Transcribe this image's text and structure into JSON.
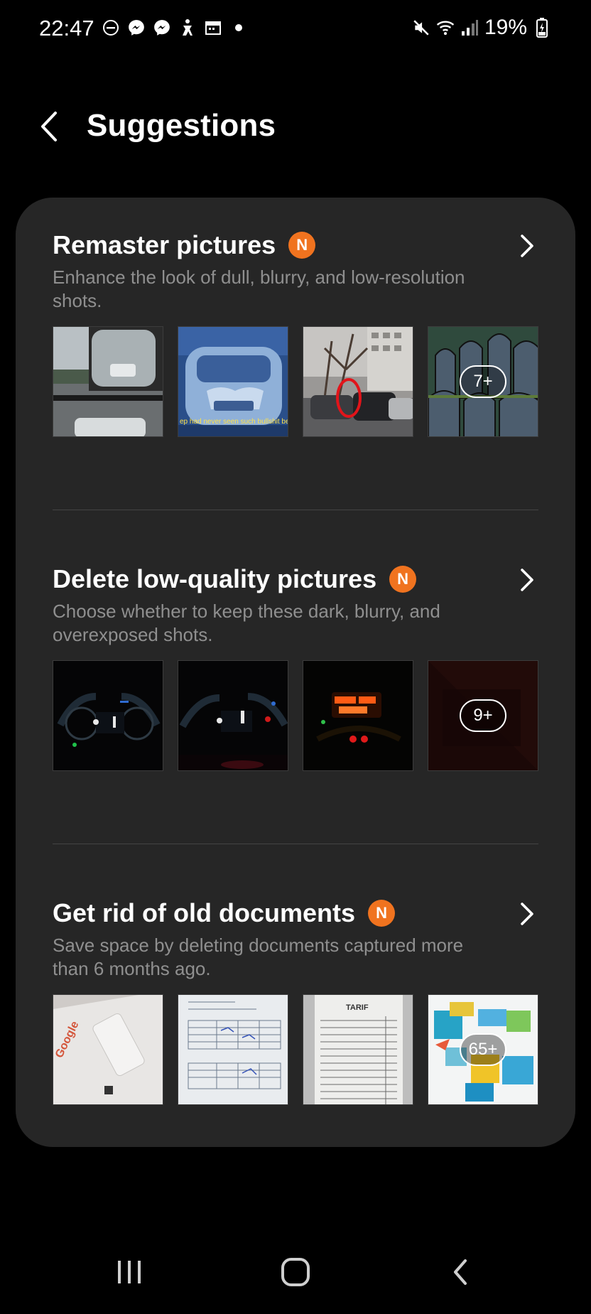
{
  "status_bar": {
    "time": "22:47",
    "battery": "19%",
    "notification_icons": [
      "do-not-disturb-icon",
      "messenger-icon",
      "messenger-icon",
      "accessibility-icon",
      "calendar-icon",
      "more-dot-icon"
    ],
    "right_icons": [
      "mute-icon",
      "wifi-icon",
      "signal-icon",
      "battery-charging-icon"
    ]
  },
  "header": {
    "title": "Suggestions"
  },
  "sections": [
    {
      "title": "Remaster pictures",
      "badge": "N",
      "description": "Enhance the look of dull, blurry, and low-resolution shots.",
      "count": "7+",
      "thumb_caption": "ep had never seen such bullshit befo"
    },
    {
      "title": "Delete low-quality pictures",
      "badge": "N",
      "description": "Choose whether to keep these dark, blurry, and overexposed shots.",
      "count": "9+"
    },
    {
      "title": "Get rid of old documents",
      "badge": "N",
      "description": "Save space by deleting documents captured more than 6 months ago.",
      "count": "65+",
      "doc_text": "Google",
      "doc_header": "TARIF"
    }
  ],
  "colors": {
    "background": "#000000",
    "card": "#262626",
    "badge": "#f0731f",
    "description": "#8f8f8f"
  }
}
